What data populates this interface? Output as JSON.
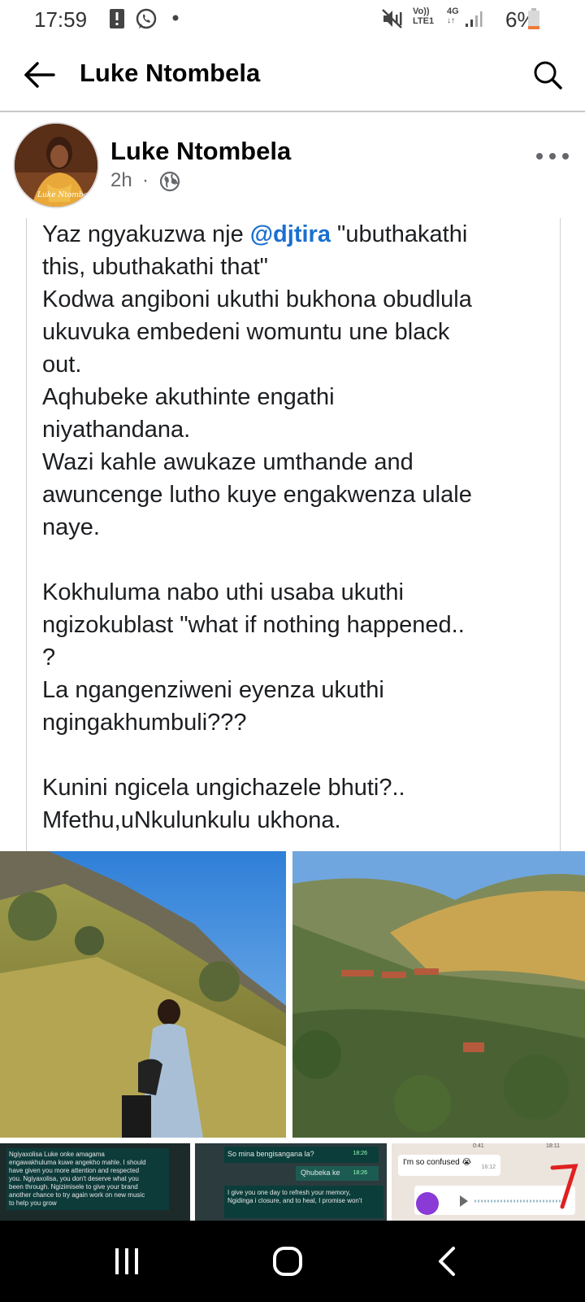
{
  "status_bar": {
    "time": "17:59",
    "network_top": "Vo))",
    "network_bottom": "LTE1",
    "data_type": "4G",
    "battery": "6%"
  },
  "header": {
    "title": "Luke Ntombela",
    "icons": [
      "back-arrow-icon",
      "search-icon"
    ]
  },
  "post": {
    "author": "Luke Ntombela",
    "time": "2h",
    "separator": "·",
    "privacy_icon": "globe-icon",
    "more_icon": "more-dots-icon",
    "mention": "@djtira",
    "lines": [
      "Yaz ngyakuzwa nje ",
      " \"ubuthakathi",
      "this, ubuthakathi that\"",
      "Kodwa angiboni ukuthi bukhona obudlula",
      "ukuvuka embedeni womuntu une black",
      "out.",
      "Aqhubeke akuthinte engathi",
      "niyathandana.",
      "Wazi kahle awukaze umthande and",
      "awuncenge lutho kuye engakwenza ulale",
      "naye.",
      "Kokhuluma nabo uthi usaba ukuthi",
      "ngizokublast \"what if nothing happened..",
      "?",
      "La ngangenziweni eyenza ukuthi",
      "ngingakhumbuli???",
      "Kunini ngicela ungichazele bhuti?..",
      "Mfethu,uNkulunkulu ukhona."
    ]
  },
  "thumbnails": {
    "thumb1_lines": [
      "Ngiyaxolisa Luke onke amagama",
      "engawakhuluma kuwe angekho mahle. I should",
      "have given you more attention and respected",
      "you. Ngiyaxolisa, you don't deserve what you",
      "been through. Ngizimisele to give your brand",
      "another chance to try again work on new music",
      "to help you grow"
    ],
    "thumb2_msg1": "So mina bengisangana la?",
    "thumb2_time1": "18:26",
    "thumb2_msg2": "Qhubeka ke",
    "thumb2_time2": "18:26",
    "thumb2_msg3_lines": [
      "I give you one day to refresh your memory,",
      "Ngidinga i closure, and to heal, I promise won't"
    ],
    "thumb3_time_left": "0:41",
    "thumb3_time_right": "18:11",
    "thumb3_msg": "I'm so confused 😭",
    "thumb3_msg_time": "16:12"
  },
  "nav_bar": {
    "icons": [
      "recents-icon",
      "home-icon",
      "back-icon"
    ]
  },
  "colors": {
    "mention": "#1b6fd0",
    "text": "#1c1e21",
    "secondary": "#65676b"
  }
}
